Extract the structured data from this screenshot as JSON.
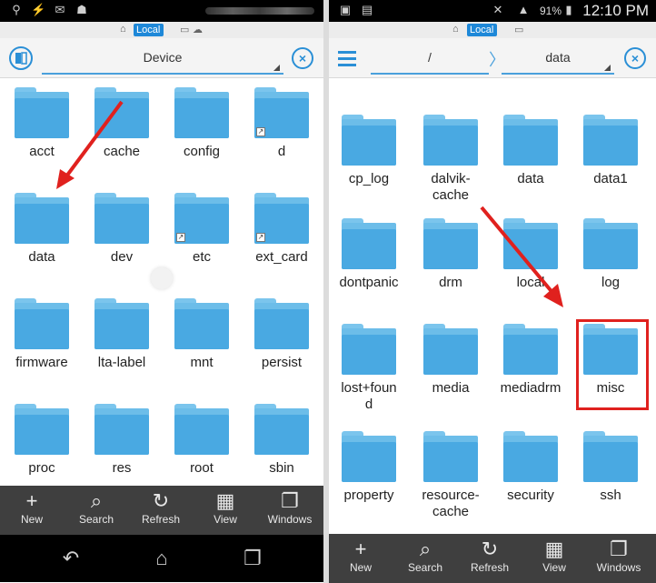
{
  "left_panel": {
    "location_label": "Local",
    "device_label": "Device",
    "folders": [
      {
        "name": "acct",
        "link": false
      },
      {
        "name": "cache",
        "link": false
      },
      {
        "name": "config",
        "link": false
      },
      {
        "name": "d",
        "link": true
      },
      {
        "name": "data",
        "link": false
      },
      {
        "name": "dev",
        "link": false
      },
      {
        "name": "etc",
        "link": true
      },
      {
        "name": "ext_card",
        "link": true
      },
      {
        "name": "firmware",
        "link": false
      },
      {
        "name": "lta-label",
        "link": false
      },
      {
        "name": "mnt",
        "link": false
      },
      {
        "name": "persist",
        "link": false
      },
      {
        "name": "proc",
        "link": false
      },
      {
        "name": "res",
        "link": false
      },
      {
        "name": "root",
        "link": false
      },
      {
        "name": "sbin",
        "link": false
      }
    ],
    "bottom_actions": [
      "New",
      "Search",
      "Refresh",
      "View",
      "Windows"
    ]
  },
  "right_panel": {
    "battery_percent": "91%",
    "time": "12:10 PM",
    "location_label": "Local",
    "path_root": "/",
    "path_current": "data",
    "folders": [
      {
        "name": "cp_log"
      },
      {
        "name": "dalvik-\ncache"
      },
      {
        "name": "data"
      },
      {
        "name": "data1"
      },
      {
        "name": "dontpanic"
      },
      {
        "name": "drm"
      },
      {
        "name": "local"
      },
      {
        "name": "log"
      },
      {
        "name": "lost+foun\nd"
      },
      {
        "name": "media"
      },
      {
        "name": "mediadrm"
      },
      {
        "name": "misc"
      },
      {
        "name": "property"
      },
      {
        "name": "resource-\ncache"
      },
      {
        "name": "security"
      },
      {
        "name": "ssh"
      }
    ],
    "highlighted_folder": "misc",
    "bottom_actions": [
      "New",
      "Search",
      "Refresh",
      "View",
      "Windows"
    ]
  },
  "colors": {
    "accent": "#2a8fd6",
    "folder": "#49a9e2",
    "highlight": "#e0211e"
  }
}
